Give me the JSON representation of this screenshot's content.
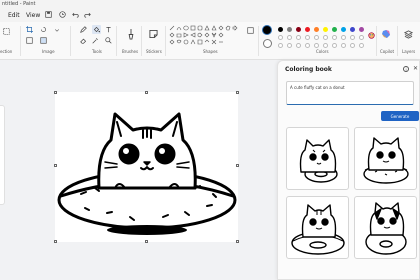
{
  "window": {
    "title": "ntitled - Paint"
  },
  "menu": {
    "edit": "Edit",
    "view": "View"
  },
  "ribbon": {
    "groups": {
      "selection": "ection",
      "image": "Image",
      "tools": "Tools",
      "brushes": "Brushes",
      "stickers": "Stickers",
      "shapes": "Shapes",
      "colors": "Colors",
      "copilot": "Copilot",
      "layers": "Layers"
    },
    "icons": [
      "save-icon",
      "undo-icon",
      "redo-icon",
      "crop-icon",
      "pencil-icon",
      "fill-icon",
      "text-icon",
      "eraser-icon",
      "color-picker-icon",
      "magnifier-icon",
      "brush-icon",
      "sticker-icon",
      "shape-icon",
      "palette-icon",
      "copilot-icon",
      "layers-icon"
    ],
    "palette": [
      "#000000",
      "#7f7f7f",
      "#880015",
      "#ed1c24",
      "#ff7f27",
      "#fff200",
      "#22b14c",
      "#00a2e8",
      "#3f48cc",
      "#a349a4",
      "#ffffff",
      "#c3c3c3"
    ],
    "primary_color": "#000000"
  },
  "coloring_book": {
    "title": "Coloring book",
    "prompt": "A cute fluffy cat on a donut",
    "generate_label": "Generate"
  }
}
